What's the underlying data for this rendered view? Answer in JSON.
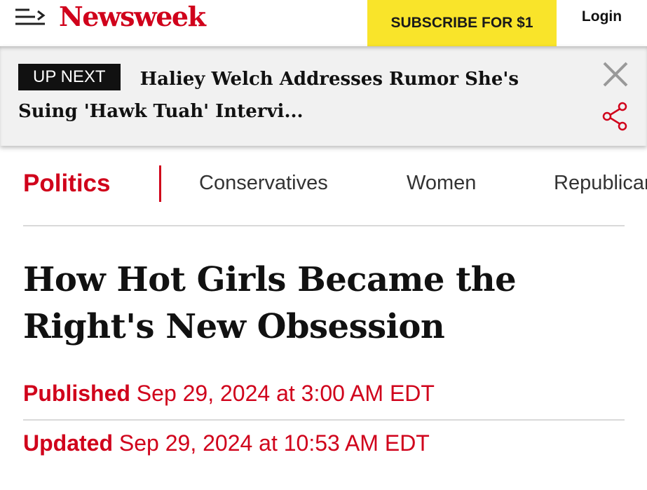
{
  "header": {
    "logo": "Newsweek",
    "subscribe_label": "SUBSCRIBE FOR $1",
    "login_label": "Login",
    "menu_icon": "menu-arrow-icon"
  },
  "up_next": {
    "badge": "UP NEXT",
    "headline": "Haliey Welch Addresses Rumor She's Suing 'Hawk Tuah' Intervi...",
    "close_icon": "close-icon",
    "share_icon": "share-icon"
  },
  "topics": {
    "primary": "Politics",
    "items": [
      "Conservatives",
      "Women",
      "Republicans"
    ]
  },
  "article": {
    "headline": "How Hot Girls Became the Right's New Obsession",
    "published_label": "Published",
    "published_date": "Sep 29, 2024 at 3:00 AM EDT",
    "updated_label": "Updated",
    "updated_date": "Sep 29, 2024 at 10:53 AM EDT"
  },
  "colors": {
    "brand_red": "#d0021b",
    "subscribe_yellow": "#f9e42a",
    "banner_gray": "#f1f1f1"
  }
}
